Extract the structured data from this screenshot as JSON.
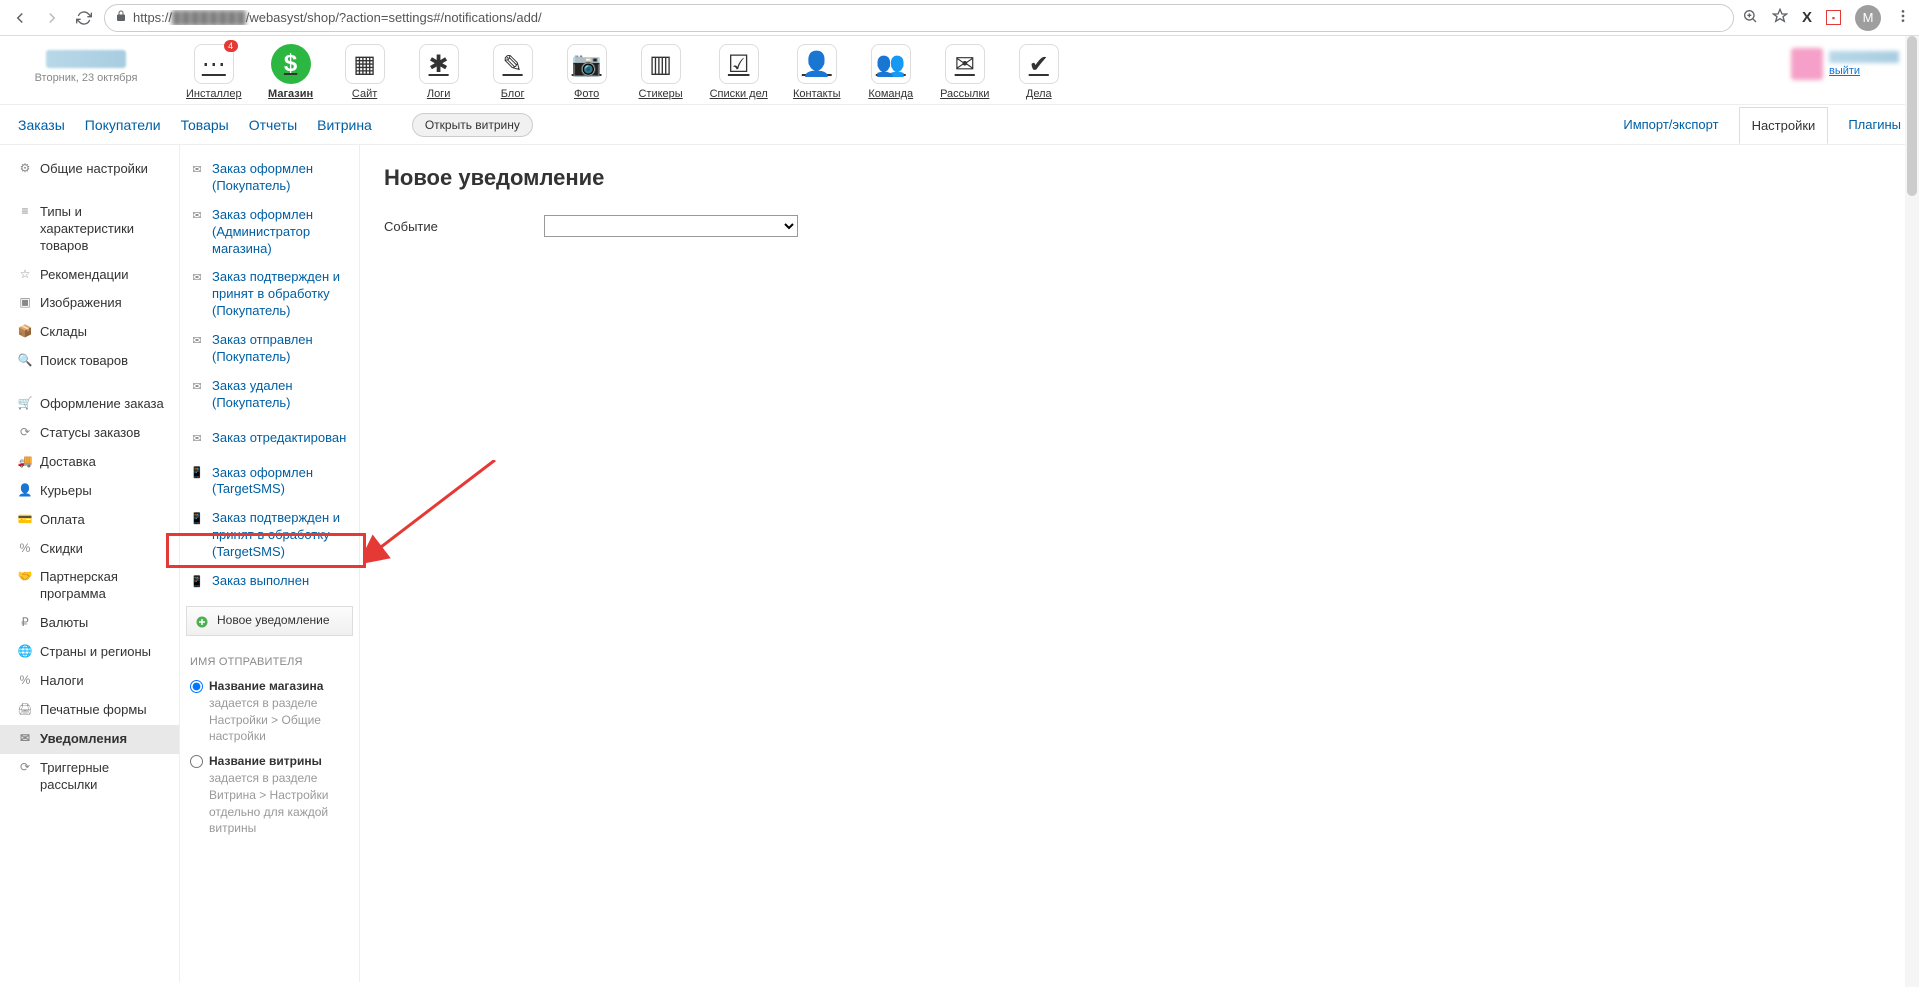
{
  "browser": {
    "url_prefix": "https://",
    "url_blurred": "████████",
    "url_suffix": "/webasyst/shop/?action=settings#/notifications/add/",
    "avatar_letter": "M"
  },
  "header": {
    "date": "Вторник, 23 октября",
    "logout": "выйти",
    "apps": [
      {
        "id": "installer",
        "label": "Инсталлер",
        "badge": "4",
        "color": "#f5f5f5",
        "emoji": "⋯"
      },
      {
        "id": "shop",
        "label": "Магазин",
        "active": true,
        "color": "#2cb742",
        "emoji": "$"
      },
      {
        "id": "site",
        "label": "Сайт",
        "color": "#4aa0e8",
        "emoji": "▦"
      },
      {
        "id": "logs",
        "label": "Логи",
        "color": "#6aaee0",
        "emoji": "✱"
      },
      {
        "id": "blog",
        "label": "Блог",
        "color": "#f8b552",
        "emoji": "✎"
      },
      {
        "id": "photos",
        "label": "Фото",
        "color": "#333",
        "emoji": "📷"
      },
      {
        "id": "stickies",
        "label": "Стикеры",
        "color": "#ffd86b",
        "emoji": "▥"
      },
      {
        "id": "checklists",
        "label": "Списки дел",
        "color": "#888",
        "emoji": "☑"
      },
      {
        "id": "contacts",
        "label": "Контакты",
        "color": "#4a88c7",
        "emoji": "👤"
      },
      {
        "id": "team",
        "label": "Команда",
        "color": "#f5c76b",
        "emoji": "👥"
      },
      {
        "id": "mailer",
        "label": "Рассылки",
        "color": "#c6a0d8",
        "emoji": "✉"
      },
      {
        "id": "tasks",
        "label": "Дела",
        "color": "#4caf50",
        "emoji": "✔"
      }
    ]
  },
  "shop_nav": {
    "left": [
      "Заказы",
      "Покупатели",
      "Товары",
      "Отчеты",
      "Витрина"
    ],
    "open_btn": "Открыть витрину",
    "right": [
      {
        "label": "Импорт/экспорт",
        "active": false
      },
      {
        "label": "Настройки",
        "active": true
      },
      {
        "label": "Плагины",
        "active": false
      }
    ]
  },
  "settings_sidebar": [
    {
      "icon": "⚙",
      "label": "Общие настройки"
    },
    {
      "gap": true
    },
    {
      "icon": "≡",
      "label": "Типы и характеристики товаров"
    },
    {
      "icon": "☆",
      "label": "Рекомендации"
    },
    {
      "icon": "▣",
      "label": "Изображения"
    },
    {
      "icon": "📦",
      "label": "Склады"
    },
    {
      "icon": "🔍",
      "label": "Поиск товаров"
    },
    {
      "gap": true
    },
    {
      "icon": "🛒",
      "label": "Оформление заказа"
    },
    {
      "icon": "⟳",
      "label": "Статусы заказов"
    },
    {
      "icon": "🚚",
      "label": "Доставка"
    },
    {
      "icon": "👤",
      "label": "Курьеры"
    },
    {
      "icon": "💳",
      "label": "Оплата"
    },
    {
      "icon": "%",
      "label": "Скидки"
    },
    {
      "icon": "🤝",
      "label": "Партнерская программа"
    },
    {
      "icon": "₽",
      "label": "Валюты"
    },
    {
      "icon": "🌐",
      "label": "Страны и регионы"
    },
    {
      "icon": "%",
      "label": "Налоги"
    },
    {
      "icon": "🖨",
      "label": "Печатные формы"
    },
    {
      "icon": "✉",
      "label": "Уведомления",
      "active": true
    },
    {
      "icon": "⟳",
      "label": "Триггерные рассылки"
    }
  ],
  "notifications_sidebar": {
    "items": [
      {
        "icon": "✉",
        "label": "Заказ оформлен (Покупатель)"
      },
      {
        "icon": "✉",
        "label": "Заказ оформлен (Администратор магазина)"
      },
      {
        "icon": "✉",
        "label": "Заказ подтвержден и принят в обработку (Покупатель)"
      },
      {
        "icon": "✉",
        "label": "Заказ отправлен (Покупатель)"
      },
      {
        "icon": "✉",
        "label": "Заказ удален (Покупатель)"
      },
      {
        "icon": "✉",
        "label": "Заказ отредактирован"
      },
      {
        "icon": "📱",
        "label": "Заказ оформлен (TargetSMS)"
      },
      {
        "icon": "📱",
        "label": "Заказ подтвержден и принят в обработку (TargetSMS)"
      },
      {
        "icon": "📱",
        "label": "Заказ выполнен"
      }
    ],
    "new_btn": "Новое уведомление",
    "sender_header": "ИМЯ ОТПРАВИТЕЛЯ",
    "radio1_bold": "Название магазина",
    "radio1_rest": " задается в разделе Настройки > Общие настройки",
    "radio2_bold": "Название витрины",
    "radio2_rest": " задается в разделе Витрина > Настройки отдельно для каждой витрины"
  },
  "content": {
    "title": "Новое уведомление",
    "event_label": "Событие"
  }
}
